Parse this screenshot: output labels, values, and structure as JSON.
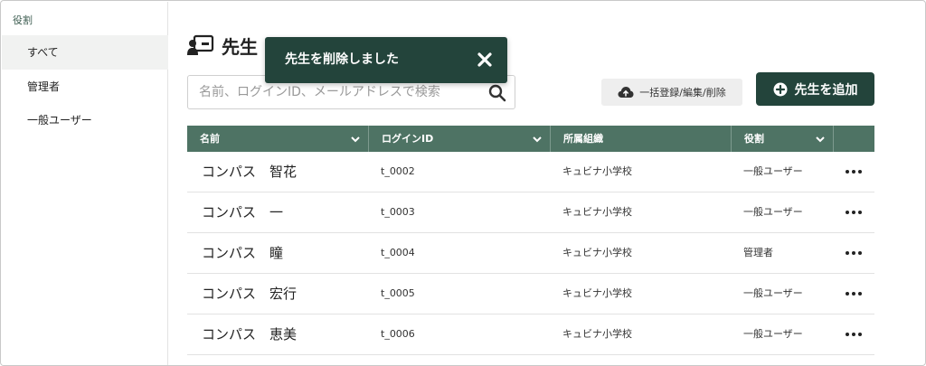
{
  "sidebar": {
    "heading": "役割",
    "items": [
      {
        "label": "すべて",
        "active": true
      },
      {
        "label": "管理者",
        "active": false
      },
      {
        "label": "一般ユーザー",
        "active": false
      }
    ]
  },
  "header": {
    "title": "先生",
    "icon": "teacher-board-icon"
  },
  "search": {
    "placeholder": "名前、ログインID、メールアドレスで検索",
    "value": ""
  },
  "toolbar": {
    "bulk_label": "一括登録/編集/削除",
    "add_label": "先生を追加"
  },
  "toast": {
    "message": "先生を削除しました"
  },
  "table": {
    "columns": [
      "名前",
      "ログインID",
      "所属組織",
      "役割"
    ],
    "rows": [
      {
        "name": "コンパス　智花",
        "login_id": "t_0002",
        "org": "キュビナ小学校",
        "role": "一般ユーザー"
      },
      {
        "name": "コンパス　一",
        "login_id": "t_0003",
        "org": "キュビナ小学校",
        "role": "一般ユーザー"
      },
      {
        "name": "コンパス　瞳",
        "login_id": "t_0004",
        "org": "キュビナ小学校",
        "role": "管理者"
      },
      {
        "name": "コンパス　宏行",
        "login_id": "t_0005",
        "org": "キュビナ小学校",
        "role": "一般ユーザー"
      },
      {
        "name": "コンパス　恵美",
        "login_id": "t_0006",
        "org": "キュビナ小学校",
        "role": "一般ユーザー"
      }
    ]
  },
  "colors": {
    "primary_dark": "#23443b",
    "header_green": "#4e7364",
    "accent_text": "#3e5e52"
  }
}
